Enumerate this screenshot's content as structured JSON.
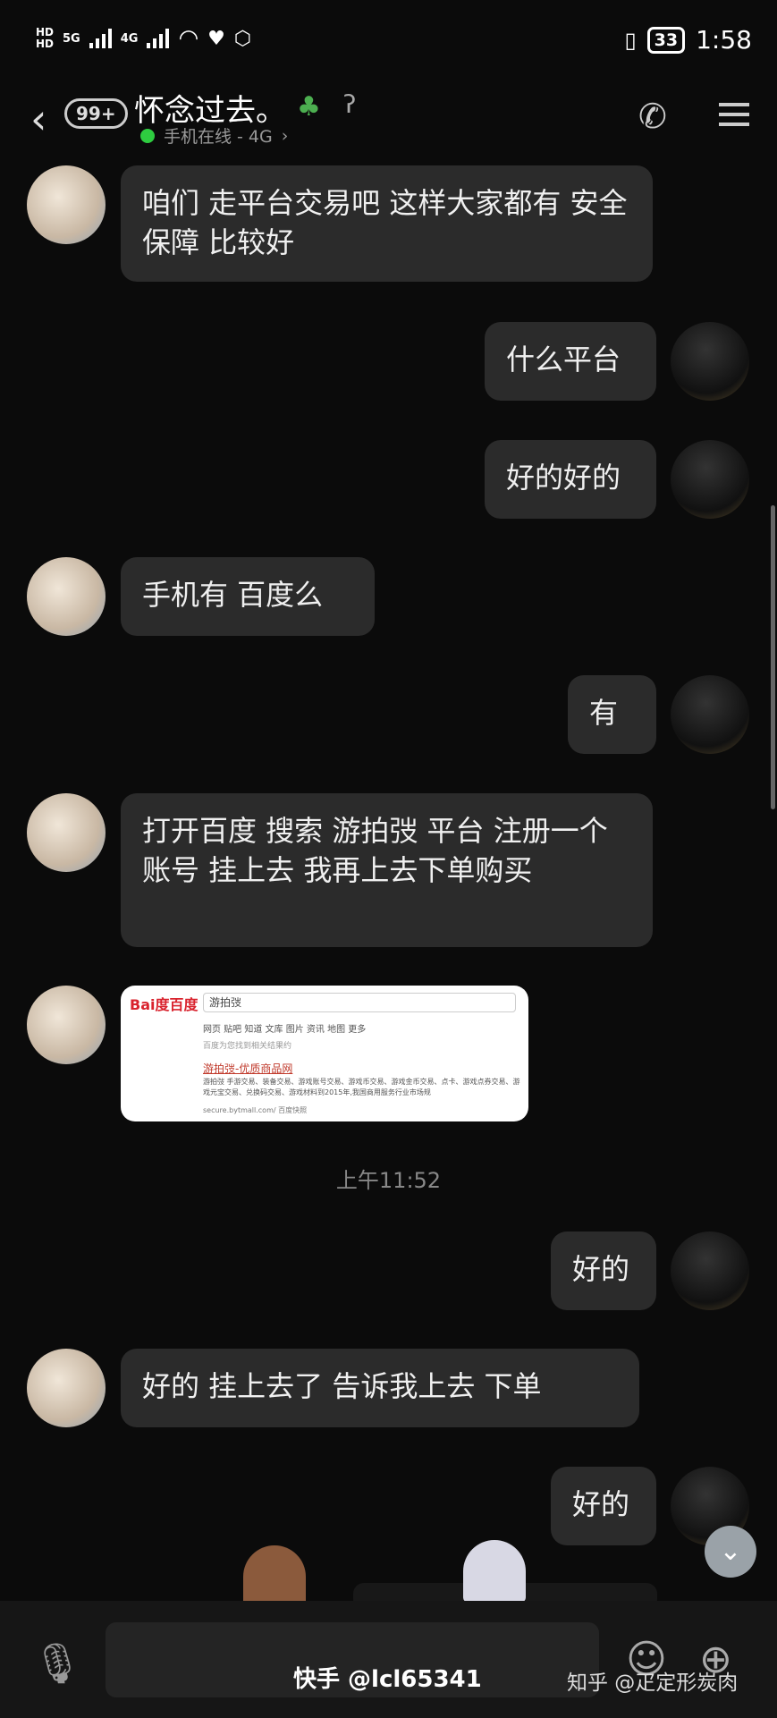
{
  "status_bar": {
    "hd_labels": [
      "HD",
      "HD"
    ],
    "net1": "5G",
    "net2": "4G",
    "battery": "33",
    "time": "1:58"
  },
  "header": {
    "back_badge": "99+",
    "contact_name": "怀念过去。",
    "online_status": "手机在线 - 4G"
  },
  "messages": [
    {
      "side": "left",
      "text": "咱们 走平台交易吧 这样大家都有 安全保障 比较好"
    },
    {
      "side": "right",
      "text": "什么平台"
    },
    {
      "side": "right",
      "text": "好的好的"
    },
    {
      "side": "left",
      "text": "手机有 百度么"
    },
    {
      "side": "right",
      "text": "有"
    },
    {
      "side": "left",
      "text": "打开百度 搜索  游拍弢  平台 注册一个账号 挂上去 我再上去下单购买"
    },
    {
      "side": "right",
      "text": "好的"
    },
    {
      "side": "left",
      "text": "好的  挂上去了 告诉我上去 下单"
    },
    {
      "side": "right",
      "text": "好的"
    }
  ],
  "image_message": {
    "logo": "Bai度百度",
    "search_text": "游拍弢",
    "tabs": "网页  贴吧  知道  文库  图片  资讯  地图  更多",
    "hint": "百度为您找到相关结果约",
    "link": "游拍弢-优质商品网",
    "desc": "游拍弢 手游交易、装备交易、游戏账号交易、游戏币交易、游戏金币交易、点卡、游戏点券交易、游戏元宝交易、兑换码交易、游戏材料到2015年,我国商用服务行业市场规",
    "url": "secure.bytmall.com/  百度快照"
  },
  "timestamp": "上午11:52",
  "input_bar": {},
  "watermarks": {
    "kuaishou": "快手 @lcl65341",
    "zhihu": "知乎 @疋定形炭肉"
  }
}
